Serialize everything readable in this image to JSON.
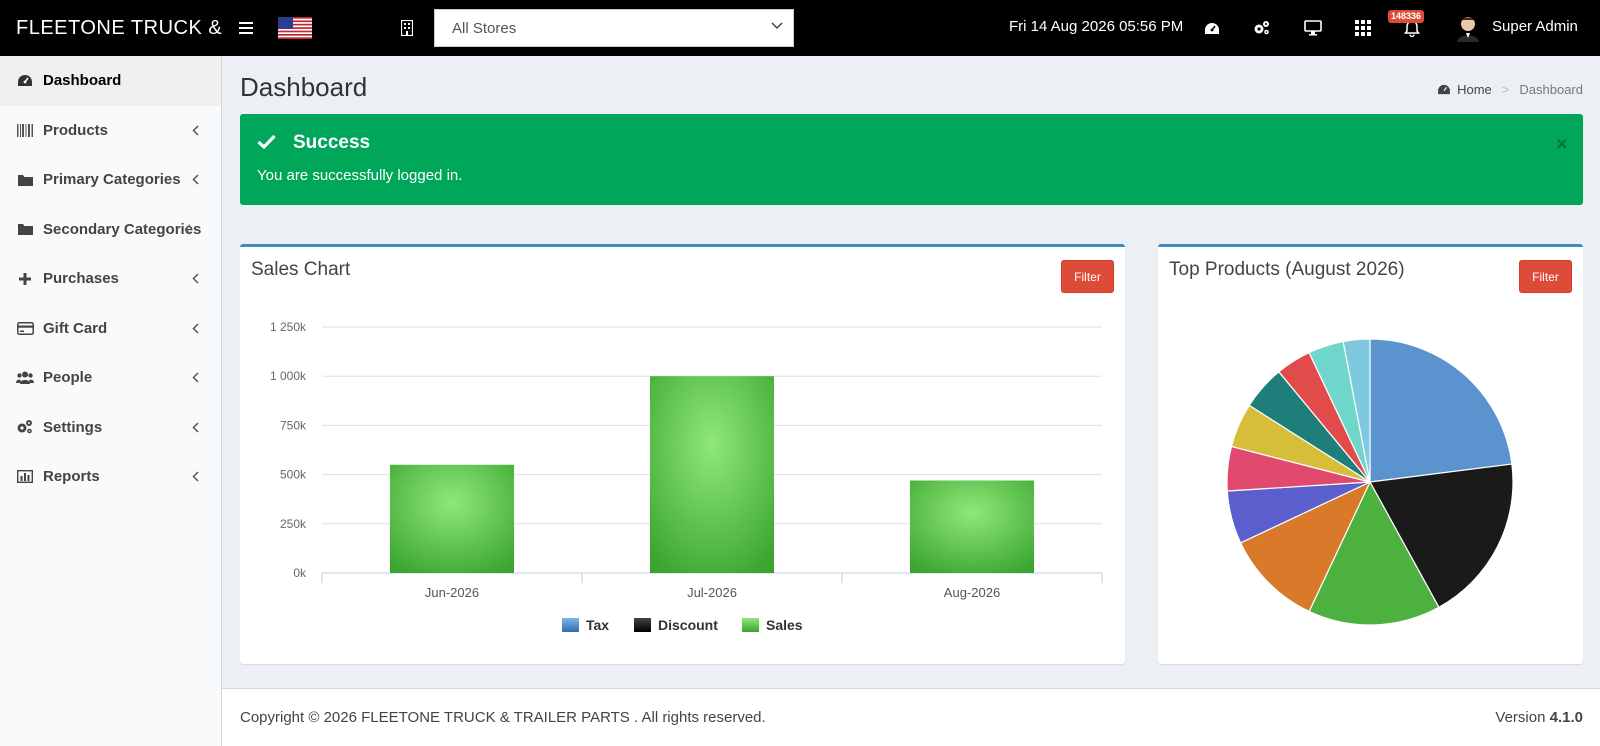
{
  "header": {
    "brand": "FLEETONE  TRUCK & TRAILER PARTS",
    "store_select": {
      "value": "All Stores"
    },
    "datetime": "Fri 14 Aug 2026 05:56 PM",
    "notification_count": "148336",
    "user_name": "Super Admin"
  },
  "sidebar": {
    "items": [
      {
        "label": "Dashboard",
        "icon": "dashboard-icon",
        "active": true
      },
      {
        "label": "Products",
        "icon": "barcode-icon"
      },
      {
        "label": "Primary Categories",
        "icon": "folder-icon"
      },
      {
        "label": "Secondary Categories",
        "icon": "folder-icon"
      },
      {
        "label": "Purchases",
        "icon": "plus-icon"
      },
      {
        "label": "Gift Card",
        "icon": "credit-card-icon"
      },
      {
        "label": "People",
        "icon": "users-icon"
      },
      {
        "label": "Settings",
        "icon": "cogs-icon"
      },
      {
        "label": "Reports",
        "icon": "bar-chart-icon"
      }
    ]
  },
  "page": {
    "title": "Dashboard",
    "breadcrumb": {
      "home": "Home",
      "current": "Dashboard"
    }
  },
  "alert": {
    "title": "Success",
    "message": "You are successfully logged in.",
    "close": "×"
  },
  "sales_box": {
    "title": "Sales Chart",
    "filter_label": "Filter"
  },
  "products_box": {
    "title": "Top Products (August 2026)",
    "filter_label": "Filter"
  },
  "chart_data": [
    {
      "type": "bar",
      "categories": [
        "Jun-2026",
        "Jul-2026",
        "Aug-2026"
      ],
      "series": [
        {
          "name": "Tax",
          "values": [
            0,
            0,
            0
          ],
          "color": "#4a86c8"
        },
        {
          "name": "Discount",
          "values": [
            0,
            0,
            0
          ],
          "color": "#111111"
        },
        {
          "name": "Sales",
          "values": [
            550000,
            1000000,
            470000
          ],
          "color": "#4cbb3c"
        }
      ],
      "yticks": [
        "0k",
        "250k",
        "500k",
        "750k",
        "1 000k",
        "1 250k"
      ],
      "ylim": [
        0,
        1250000
      ],
      "grid": true,
      "legend": "bottom"
    },
    {
      "type": "pie",
      "values": [
        23,
        19,
        15,
        11,
        6,
        5,
        5,
        5,
        4,
        4,
        3
      ],
      "colors": [
        "#5b93cf",
        "#1a1a1a",
        "#4cb13f",
        "#d9792a",
        "#5b5fce",
        "#e04a6e",
        "#d6bd3a",
        "#1e7f7a",
        "#e24b4b",
        "#6fd6cc",
        "#7ec8e0"
      ]
    }
  ],
  "footer": {
    "copyright": "Copyright © 2026 FLEETONE  TRUCK & TRAILER PARTS . All rights reserved.",
    "version_label": "Version",
    "version": "4.1.0"
  }
}
